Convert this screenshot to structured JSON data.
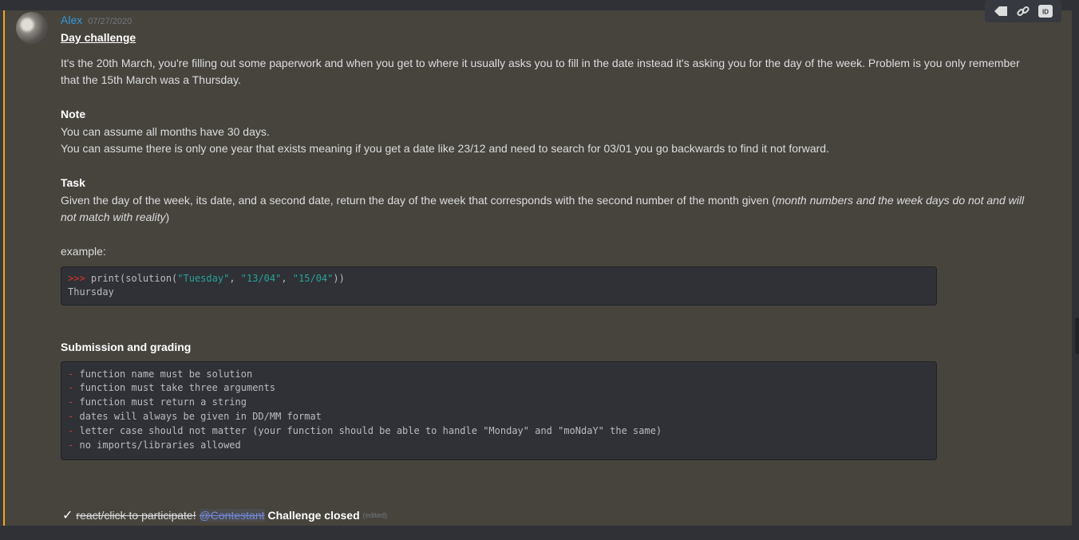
{
  "message": {
    "author": "Alex",
    "timestamp": "07/27/2020",
    "title": "Day challenge",
    "intro": "It's the 20th March, you're filling out some paperwork and when you get to where it usually asks you to fill in the date instead it's asking you for the day of the week. Problem is you only remember that the 15th March was a Thursday.",
    "note_heading": "Note",
    "note_lines": [
      "You can assume all months have 30 days.",
      "You can assume there is only one year that exists meaning if you get a date like 23/12 and need to search for 03/01 you go backwards to find it not forward."
    ],
    "task_heading": "Task",
    "task_text": "Given the day of the week, its date, and a second date, return the day of the week that corresponds with the second number of the month given (",
    "task_italic": "month numbers and the week days do not and will not match with reality",
    "task_end": ")",
    "example_label": "example:",
    "example_code": {
      "prompt": ">>>",
      "call_pre": " print(solution(",
      "arg1": "\"Tuesday\"",
      "sep1": ", ",
      "arg2": "\"13/04\"",
      "sep2": ", ",
      "arg3": "\"15/04\"",
      "call_post": "))",
      "output": "Thursday"
    },
    "submission_heading": "Submission and grading",
    "rules_dash": "-",
    "rules": [
      "function name must be solution",
      "function must take three arguments",
      "function must return a string",
      "dates will always be given in DD/MM format",
      "letter case should not matter (your function should be able to handle \"Monday\" and \"moNdaY\" the same)",
      "no imports/libraries allowed"
    ],
    "footer": {
      "checkmark": "✓",
      "struck_text": "react/click to participate!",
      "mention": "@Contestant",
      "closed_text": "Challenge closed",
      "edited": "(edited)"
    }
  },
  "toolbar": {
    "icons": [
      "tag-icon",
      "link-icon",
      "id-icon"
    ],
    "id_label": "ID"
  },
  "colors": {
    "accent_bar": "#faa61a",
    "author": "#3498db",
    "mention": "#7289da",
    "message_bg": "#47443d"
  }
}
